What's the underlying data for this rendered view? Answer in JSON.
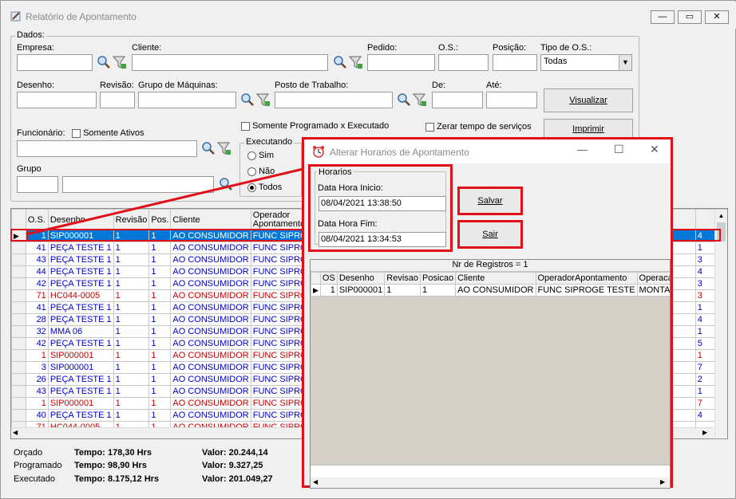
{
  "window": {
    "title": "Relatório de Apontamento"
  },
  "dados": {
    "group_label": "Dados:",
    "empresa_label": "Empresa:",
    "cliente_label": "Cliente:",
    "pedido_label": "Pedido:",
    "os_label": "O.S.:",
    "posicao_label": "Posição:",
    "tipo_os_label": "Tipo de O.S.:",
    "tipo_os_value": "Todas",
    "desenho_label": "Desenho:",
    "revisao_label": "Revisão:",
    "grupo_maquinas_label": "Grupo de Máquinas:",
    "posto_label": "Posto de Trabalho:",
    "de_label": "De:",
    "ate_label": "Até:",
    "visualizar_label": "Visualizar",
    "imprimir_label": "Imprimir",
    "prog_exec_label": "Somente Programado x Executado",
    "zerar_label": "Zerar tempo de serviços",
    "funcionario_label": "Funcionário:",
    "somente_ativos_label": "Somente Ativos",
    "grupo_label": "Grupo",
    "executando_label": "Executando",
    "exec_options": [
      "Sim",
      "Não",
      "Todos"
    ]
  },
  "grid": {
    "headers": [
      "O.S.",
      "Desenho",
      "Revisão",
      "Pos.",
      "Cliente",
      "Operador Apontamento"
    ],
    "rows": [
      {
        "os": "1",
        "desenho": "SIP000001",
        "rev": "1",
        "pos": "1",
        "cliente": "AO CONSUMIDOR",
        "operador": "FUNC SIPROGE",
        "right": "4",
        "color": "sel"
      },
      {
        "os": "41",
        "desenho": "PEÇA TESTE 1",
        "rev": "1",
        "pos": "1",
        "cliente": "AO CONSUMIDOR",
        "operador": "FUNC SIPROGE",
        "right": "1",
        "color": "blue"
      },
      {
        "os": "43",
        "desenho": "PEÇA TESTE 1",
        "rev": "1",
        "pos": "1",
        "cliente": "AO CONSUMIDOR",
        "operador": "FUNC SIPROGE",
        "right": "3",
        "color": "blue"
      },
      {
        "os": "44",
        "desenho": "PEÇA TESTE 1",
        "rev": "1",
        "pos": "1",
        "cliente": "AO CONSUMIDOR",
        "operador": "FUNC SIPROGE",
        "right": "4",
        "color": "blue"
      },
      {
        "os": "42",
        "desenho": "PEÇA TESTE 1",
        "rev": "1",
        "pos": "1",
        "cliente": "AO CONSUMIDOR",
        "operador": "FUNC SIPROGE",
        "right": "3",
        "color": "blue"
      },
      {
        "os": "71",
        "desenho": "HC044-0005",
        "rev": "1",
        "pos": "1",
        "cliente": "AO CONSUMIDOR",
        "operador": "FUNC SIPROGE",
        "right": "3",
        "color": "red"
      },
      {
        "os": "41",
        "desenho": "PEÇA TESTE 1",
        "rev": "1",
        "pos": "1",
        "cliente": "AO CONSUMIDOR",
        "operador": "FUNC SIPROGE",
        "right": "1",
        "color": "blue"
      },
      {
        "os": "28",
        "desenho": "PEÇA TESTE 1",
        "rev": "1",
        "pos": "1",
        "cliente": "AO CONSUMIDOR",
        "operador": "FUNC SIPROGE",
        "right": "4",
        "color": "blue"
      },
      {
        "os": "32",
        "desenho": "MMA 06",
        "rev": "1",
        "pos": "1",
        "cliente": "AO CONSUMIDOR",
        "operador": "FUNC SIPROGE",
        "right": "1",
        "color": "blue"
      },
      {
        "os": "42",
        "desenho": "PEÇA TESTE 1",
        "rev": "1",
        "pos": "1",
        "cliente": "AO CONSUMIDOR",
        "operador": "FUNC SIPROGE",
        "right": "5",
        "color": "blue"
      },
      {
        "os": "1",
        "desenho": "SIP000001",
        "rev": "1",
        "pos": "1",
        "cliente": "AO CONSUMIDOR",
        "operador": "FUNC SIPROGE",
        "right": "1",
        "color": "red"
      },
      {
        "os": "3",
        "desenho": "SIP000001",
        "rev": "1",
        "pos": "1",
        "cliente": "AO CONSUMIDOR",
        "operador": "FUNC SIPROGE",
        "right": "7",
        "color": "blue"
      },
      {
        "os": "26",
        "desenho": "PEÇA TESTE 1",
        "rev": "1",
        "pos": "1",
        "cliente": "AO CONSUMIDOR",
        "operador": "FUNC SIPROGE",
        "right": "2",
        "color": "blue"
      },
      {
        "os": "43",
        "desenho": "PEÇA TESTE 1",
        "rev": "1",
        "pos": "1",
        "cliente": "AO CONSUMIDOR",
        "operador": "FUNC SIPROGE",
        "right": "1",
        "color": "blue"
      },
      {
        "os": "1",
        "desenho": "SIP000001",
        "rev": "1",
        "pos": "1",
        "cliente": "AO CONSUMIDOR",
        "operador": "FUNC SIPROGE",
        "right": "7",
        "color": "red"
      },
      {
        "os": "40",
        "desenho": "PEÇA TESTE 1",
        "rev": "1",
        "pos": "1",
        "cliente": "AO CONSUMIDOR",
        "operador": "FUNC SIPROGE",
        "right": "4",
        "color": "blue"
      },
      {
        "os": "71",
        "desenho": "HC044-0005",
        "rev": "1",
        "pos": "1",
        "cliente": "AO CONSUMIDOR",
        "operador": "FUNC SIPROGE",
        "right": "",
        "color": "red"
      }
    ]
  },
  "summary": {
    "orcado_label": "Orçado",
    "programado_label": "Programado",
    "executado_label": "Executado",
    "orcado_tempo": "Tempo: 178,30 Hrs",
    "programado_tempo": "Tempo: 98,90 Hrs",
    "executado_tempo": "Tempo: 8.175,12 Hrs",
    "orcado_valor": "Valor: 20.244,14",
    "programado_valor": "Valor: 9.327,25",
    "executado_valor": "Valor: 201.049,27"
  },
  "dialog": {
    "title": "Alterar Horarios de Apontamento",
    "horarios_label": "Horarios",
    "inicio_label": "Data Hora Inicio:",
    "inicio_value": "08/04/2021 13:38:50",
    "fim_label": "Data Hora Fim:",
    "fim_value": "08/04/2021 13:34:53",
    "salvar_label": "Salvar",
    "sair_label": "Sair",
    "nr_registros": "Nr de Registros = 1",
    "headers": [
      "OS",
      "Desenho",
      "Revisao",
      "Posicao",
      "Cliente",
      "OperadorApontamento",
      "OperacaoAp"
    ],
    "row": {
      "os": "1",
      "desenho": "SIP000001",
      "revisao": "1",
      "posicao": "1",
      "cliente": "AO CONSUMIDOR",
      "operador": "FUNC SIPROGE TESTE",
      "operacao": "MONTAGEM"
    }
  },
  "colors": {
    "accent_red": "#e0101a",
    "row_blue": "#0000cc",
    "row_red": "#cc0000",
    "selection": "#0078d7"
  }
}
